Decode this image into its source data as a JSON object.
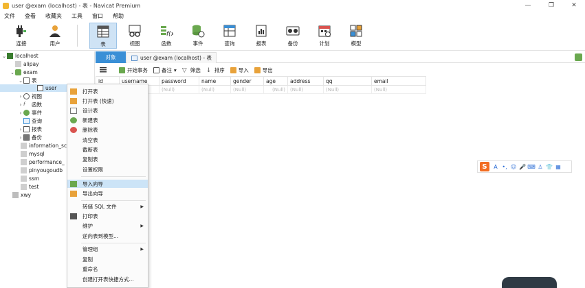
{
  "window": {
    "title": "user @exam (localhost) - 表 - Navicat Premium",
    "min_glyph": "—",
    "max_glyph": "❐",
    "close_glyph": "✕"
  },
  "menubar": [
    "文件",
    "查看",
    "收藏夹",
    "工具",
    "窗口",
    "帮助"
  ],
  "toolbar": [
    {
      "label": "连接",
      "icon": "plug-icon"
    },
    {
      "label": "用户",
      "icon": "user-icon"
    },
    {
      "label": "表",
      "icon": "table-icon",
      "active": true
    },
    {
      "label": "视图",
      "icon": "view-icon"
    },
    {
      "label": "函数",
      "icon": "function-icon"
    },
    {
      "label": "事件",
      "icon": "event-icon"
    },
    {
      "label": "查询",
      "icon": "query-icon"
    },
    {
      "label": "报表",
      "icon": "report-icon"
    },
    {
      "label": "备份",
      "icon": "backup-icon"
    },
    {
      "label": "计划",
      "icon": "schedule-icon"
    },
    {
      "label": "模型",
      "icon": "model-icon"
    }
  ],
  "tree": {
    "connection": "localhost",
    "databases": [
      "alipay",
      "exam",
      "information_sc",
      "mysql",
      "performance_",
      "pinyougoudb",
      "ssm",
      "test"
    ],
    "exam_children": {
      "tables": "表",
      "table_user": "user",
      "views": "视图",
      "functions": "函数",
      "events": "事件",
      "queries": "查询",
      "reports": "报表",
      "backups": "备份"
    },
    "other_connection": "xwy"
  },
  "tabs": {
    "objects": "对象",
    "current": "user @exam (localhost) - 表"
  },
  "gridbar": {
    "begin_txn": "开始事务",
    "note": "备注",
    "filter": "筛选",
    "sort": "排序",
    "import": "导入",
    "export": "导出"
  },
  "grid": {
    "columns": [
      "id",
      "username",
      "password",
      "name",
      "gender",
      "age",
      "address",
      "qq",
      "email"
    ],
    "null_text": "(Null)"
  },
  "context_menu": {
    "items": [
      "打开表",
      "打开表 (快速)",
      "设计表",
      "新建表",
      "删除表",
      "清空表",
      "截断表",
      "复制表",
      "设置权限",
      "导入向导",
      "导出向导",
      "转储 SQL 文件",
      "打印表",
      "维护",
      "逆向表到模型...",
      "管理组",
      "复制",
      "重命名",
      "创建打开表快捷方式..."
    ],
    "highlighted": "导入向导"
  },
  "ime": {
    "logo": "S",
    "items": [
      "A",
      "•,",
      "☺",
      "🎤",
      "⌨",
      "♙",
      "👕",
      "▦"
    ]
  }
}
